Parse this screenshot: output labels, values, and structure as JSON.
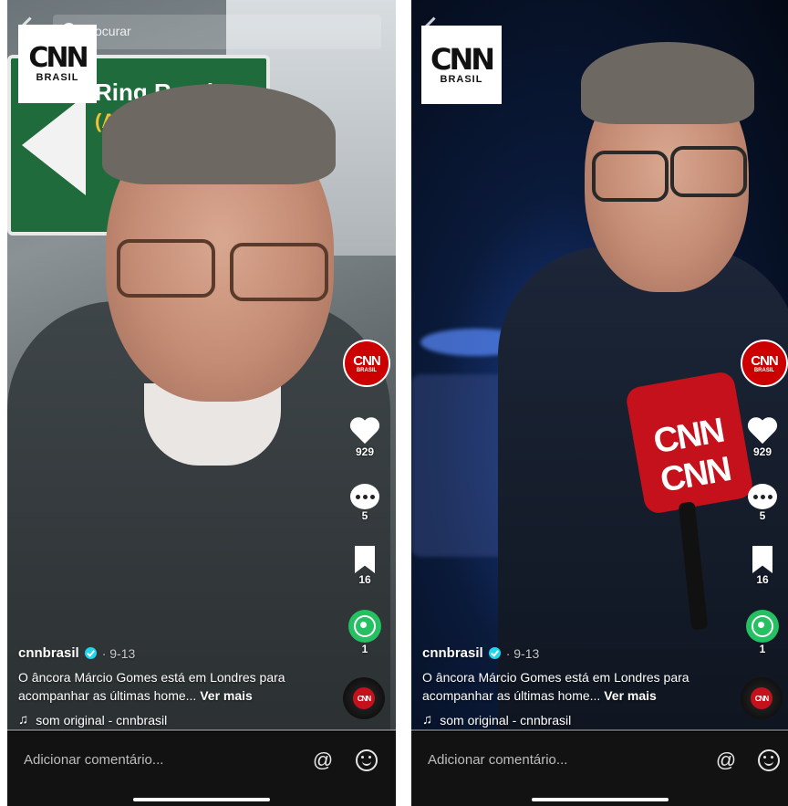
{
  "left": {
    "search_placeholder": "Procurar",
    "logo_mark": "CNN",
    "logo_sub": "BRASIL",
    "sign_text": "Ring Road",
    "sign_sub": "(A4",
    "avatar_mark": "CNN",
    "avatar_sub": "BRASIL",
    "likes": "929",
    "comments": "5",
    "saves": "16",
    "shares": "1",
    "username": "cnnbrasil",
    "date": "· 9-13",
    "caption": "O âncora Márcio Gomes está em Londres para acompanhar as últimas home...",
    "more": "Ver mais",
    "sound": "som original - cnnbrasil",
    "disc_mark": "CNN",
    "comment_placeholder": "Adicionar comentário...",
    "at_symbol": "@"
  },
  "right": {
    "logo_mark": "CNN",
    "logo_sub": "BRASIL",
    "mic_text": "CNN CNN",
    "avatar_mark": "CNN",
    "avatar_sub": "BRASIL",
    "likes": "929",
    "comments": "5",
    "saves": "16",
    "shares": "1",
    "username": "cnnbrasil",
    "date": "· 9-13",
    "caption": "O âncora Márcio Gomes está em Londres para acompanhar as últimas home...",
    "more": "Ver mais",
    "sound": "som original - cnnbrasil",
    "disc_mark": "CNN",
    "comment_placeholder": "Adicionar comentário...",
    "at_symbol": "@"
  },
  "colors": {
    "brand_red": "#cc0000",
    "whatsapp_green": "#25c061",
    "verified_blue": "#20d5ec"
  },
  "icons": [
    "back-icon",
    "search-icon",
    "heart-icon",
    "comment-icon",
    "bookmark-icon",
    "whatsapp-icon",
    "verified-icon",
    "music-note-icon",
    "at-icon",
    "emoji-icon"
  ]
}
